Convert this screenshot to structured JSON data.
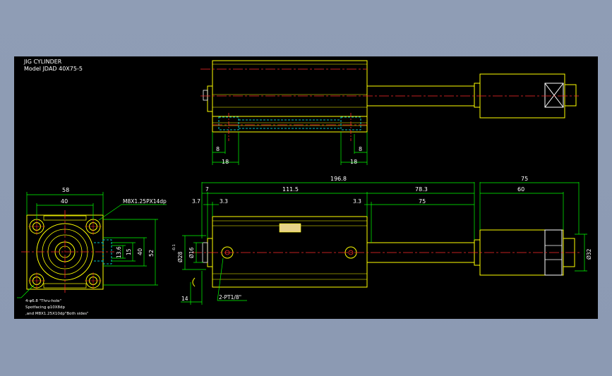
{
  "title_block": {
    "title": "JIG CYLINDER",
    "model": "Model  JDAD 40X75-5"
  },
  "top_view": {
    "dims": {
      "left_gap": "8",
      "left_width": "18",
      "right_gap": "8",
      "right_width": "18"
    }
  },
  "end_view": {
    "dims": {
      "overall_width": "58",
      "hole_pitch": "40",
      "thread_callout": "M8X1.25PX14dp",
      "dim_13_6": "13.6",
      "dim_15": "15",
      "dim_40": "40",
      "dim_52": "52"
    },
    "notes": [
      "4-φ6.8 \"Thru-hole\"",
      "Spotfacing φ10X8dp",
      ",and M8X1.25X10dp\"Both sides\""
    ]
  },
  "side_view": {
    "dims": {
      "total_length": "196.8",
      "block_length": "75",
      "dim_7": "7",
      "dim_111_5": "111.5",
      "dim_78_3": "78.3",
      "dim_60": "60",
      "dim_3_7": "3.7",
      "dim_3_3_left": "3.3",
      "dim_3_3_right": "3.3",
      "stroke": "75",
      "dia_28": "Ø28",
      "tol_28": "-0.1",
      "dia_16": "Ø16",
      "dim_14": "14",
      "dia_32": "Ø32",
      "ports": "2-PT1/8\""
    }
  },
  "colors": {
    "background": "#000000",
    "outline": "#ffff00",
    "centerline": "#ff2a2a",
    "dimension": "#00ff00",
    "hidden": "#00ffff",
    "detail": "#ffffff"
  }
}
